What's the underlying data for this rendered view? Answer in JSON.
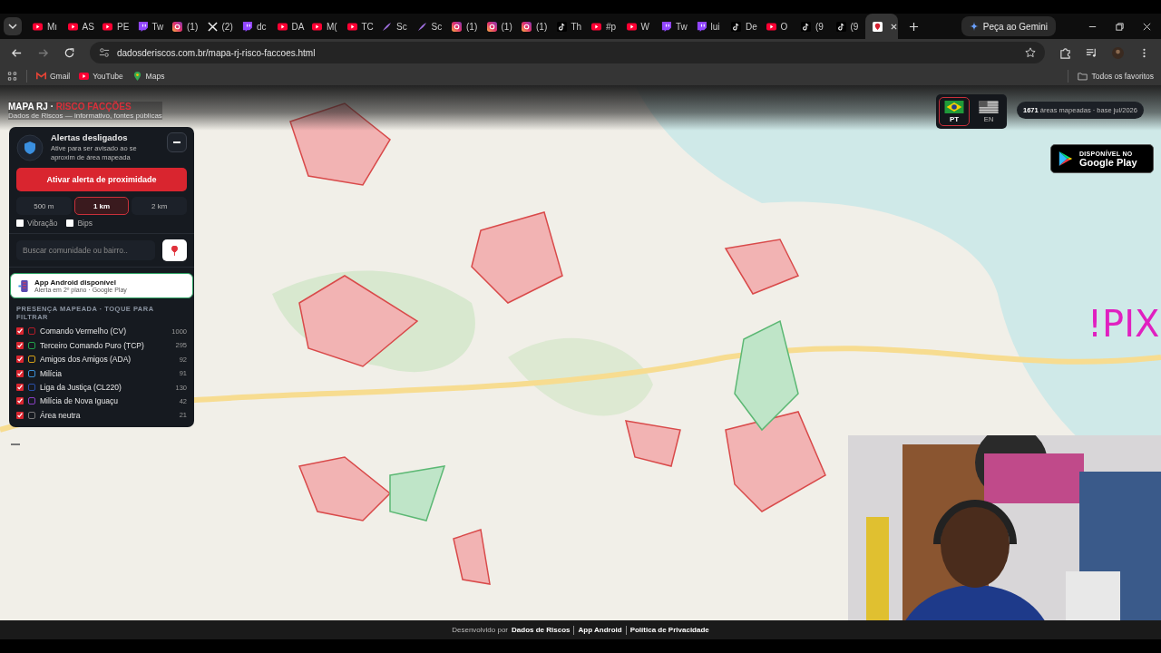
{
  "browser": {
    "tabs": [
      {
        "kind": "youtube",
        "title": "Mı",
        "selected": false
      },
      {
        "kind": "youtube",
        "title": "AS",
        "selected": false
      },
      {
        "kind": "youtube",
        "title": "PE",
        "selected": false
      },
      {
        "kind": "twitch",
        "title": "Tw",
        "selected": false
      },
      {
        "kind": "instagram",
        "title": "(1)",
        "selected": false
      },
      {
        "kind": "x",
        "title": "(2)",
        "selected": false
      },
      {
        "kind": "twitch",
        "title": "dc",
        "selected": false
      },
      {
        "kind": "youtube",
        "title": "DA",
        "selected": false
      },
      {
        "kind": "youtube",
        "title": "M(",
        "selected": false
      },
      {
        "kind": "youtube",
        "title": "TC",
        "selected": false
      },
      {
        "kind": "feather",
        "title": "Sc",
        "selected": false
      },
      {
        "kind": "feather",
        "title": "Sc",
        "selected": false
      },
      {
        "kind": "instagram",
        "title": "(1)",
        "selected": false
      },
      {
        "kind": "instagram",
        "title": "(1)",
        "selected": false
      },
      {
        "kind": "instagram",
        "title": "(1)",
        "selected": false
      },
      {
        "kind": "tiktok",
        "title": "Th",
        "selected": false
      },
      {
        "kind": "youtube",
        "title": "#p",
        "selected": false
      },
      {
        "kind": "youtube",
        "title": "W",
        "selected": false
      },
      {
        "kind": "twitch",
        "title": "Tw",
        "selected": false
      },
      {
        "kind": "twitch",
        "title": "lui",
        "selected": false
      },
      {
        "kind": "tiktok",
        "title": "De",
        "selected": false
      },
      {
        "kind": "youtube",
        "title": "O",
        "selected": false
      },
      {
        "kind": "tiktok",
        "title": "(9",
        "selected": false
      },
      {
        "kind": "tiktok",
        "title": "(9",
        "selected": false
      },
      {
        "kind": "site",
        "selected": true
      }
    ],
    "gemini_button": "Peça ao Gemini",
    "url": "dadosderiscos.com.br/mapa-rj-risco-faccoes.html",
    "bookmarks": [
      {
        "kind": "gmail",
        "label": "Gmail"
      },
      {
        "kind": "youtube",
        "label": "YouTube"
      },
      {
        "kind": "maps",
        "label": "Maps"
      }
    ],
    "all_bookmarks": "Todos os favoritos"
  },
  "header": {
    "title": "MAPA RJ ·",
    "title_accent": "RISCO FACÇÕES",
    "subtitle": "Dados de Riscos — informativo, fontes públicas"
  },
  "alerts": {
    "title": "Alertas desligados",
    "description": "Ative para ser avisado ao se aproxim de área mapeada",
    "button": "Ativar alerta de proximidade",
    "radii": [
      {
        "label": "500 m",
        "selected": false
      },
      {
        "label": "1 km",
        "selected": true
      },
      {
        "label": "2 km",
        "selected": false
      }
    ],
    "options": [
      {
        "label": "Vibração",
        "checked": false
      },
      {
        "label": "Bips",
        "checked": false
      }
    ]
  },
  "search": {
    "placeholder": "Buscar comunidade ou bairro.."
  },
  "app_banner": {
    "title": "App Android disponível",
    "subtitle": "Alerta em 2º plano · Google Play"
  },
  "legend": {
    "heading": "PRESENÇA MAPEADA · TOQUE PARA FILTRAR",
    "items": [
      {
        "name": "Comando Vermelho (CV)",
        "count": "1000",
        "checked": true,
        "color": "#b01c28"
      },
      {
        "name": "Terceiro Comando Puro (TCP)",
        "count": "295",
        "checked": true,
        "color": "#22a04a"
      },
      {
        "name": "Amigos dos Amigos (ADA)",
        "count": "92",
        "checked": true,
        "color": "#d4a017"
      },
      {
        "name": "Milícia",
        "count": "91",
        "checked": true,
        "color": "#3b8fd4"
      },
      {
        "name": "Liga da Justiça (CL220)",
        "count": "130",
        "checked": true,
        "color": "#2a4fa8"
      },
      {
        "name": "Milícia de Nova Iguaçu",
        "count": "42",
        "checked": true,
        "color": "#8a3fc4"
      },
      {
        "name": "Área neutra",
        "count": "21",
        "checked": true,
        "color": "#777777"
      }
    ]
  },
  "languages": [
    {
      "code": "PT",
      "kind": "br",
      "selected": true
    },
    {
      "code": "EN",
      "kind": "us",
      "selected": false
    }
  ],
  "stats": {
    "count": "1671",
    "text": "áreas mapeadas · base jul/2026"
  },
  "store_badge": {
    "caption": "DISPONÍVEL NO",
    "store": "Google Play"
  },
  "overlay_text": "!PIX",
  "footer": {
    "prefix": "Desenvolvido por",
    "links": [
      "Dados de Riscos",
      "App Android",
      "Política de Privacidade"
    ]
  }
}
